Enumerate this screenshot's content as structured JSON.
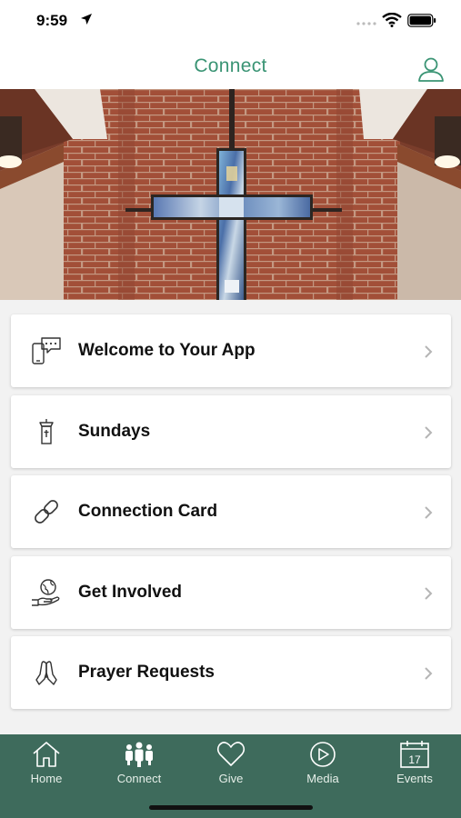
{
  "status": {
    "time": "9:59"
  },
  "header": {
    "title": "Connect"
  },
  "menu": [
    {
      "label": "Welcome to Your App",
      "icon": "chat-phone-icon"
    },
    {
      "label": "Sundays",
      "icon": "pulpit-icon"
    },
    {
      "label": "Connection Card",
      "icon": "link-icon"
    },
    {
      "label": "Get Involved",
      "icon": "globe-hand-icon"
    },
    {
      "label": "Prayer Requests",
      "icon": "praying-hands-icon"
    }
  ],
  "tabs": [
    {
      "label": "Home",
      "icon": "home-icon"
    },
    {
      "label": "Connect",
      "icon": "people-icon",
      "active": true
    },
    {
      "label": "Give",
      "icon": "heart-icon"
    },
    {
      "label": "Media",
      "icon": "play-icon"
    },
    {
      "label": "Events",
      "icon": "calendar-icon",
      "day": "17"
    }
  ],
  "colors": {
    "accent": "#3a9474",
    "tab_bar": "#3e6b5c",
    "brick": "#a0503a"
  }
}
